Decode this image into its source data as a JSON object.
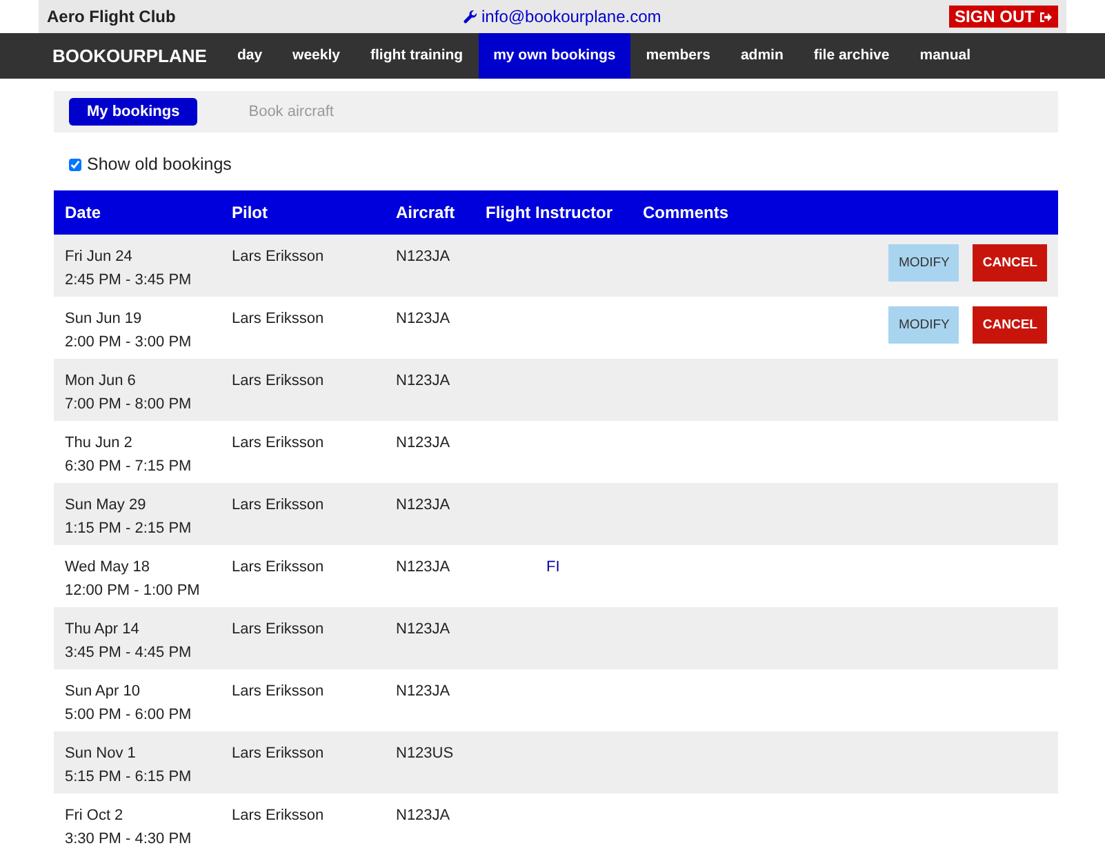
{
  "topbar": {
    "club": "Aero Flight Club",
    "email": "info@bookourplane.com",
    "sign_out": "SIGN OUT"
  },
  "navbar": {
    "brand": "BOOKOURPLANE",
    "items": [
      {
        "label": "day",
        "selected": false
      },
      {
        "label": "weekly",
        "selected": false
      },
      {
        "label": "flight training",
        "selected": false
      },
      {
        "label": "my own bookings",
        "selected": true
      },
      {
        "label": "members",
        "selected": false
      },
      {
        "label": "admin",
        "selected": false
      },
      {
        "label": "file archive",
        "selected": false
      },
      {
        "label": "manual",
        "selected": false
      }
    ]
  },
  "subnav": [
    {
      "label": "My bookings",
      "selected": true
    },
    {
      "label": "Book aircraft",
      "selected": false
    }
  ],
  "show_old": {
    "label": "Show old bookings",
    "checked": true
  },
  "table": {
    "columns": [
      "Date",
      "Pilot",
      "Aircraft",
      "Flight Instructor",
      "Comments"
    ],
    "rows": [
      {
        "date": "Fri Jun 24",
        "time": "2:45 PM - 3:45 PM",
        "pilot": "Lars Eriksson",
        "aircraft": "N123JA",
        "actions": [
          "MODIFY",
          "CANCEL"
        ]
      },
      {
        "date": "Sun Jun 19",
        "time": "2:00 PM - 3:00 PM",
        "pilot": "Lars Eriksson",
        "aircraft": "N123JA",
        "actions": [
          "MODIFY",
          "CANCEL"
        ]
      },
      {
        "date": "Mon Jun 6",
        "time": "7:00 PM - 8:00 PM",
        "pilot": "Lars Eriksson",
        "aircraft": "N123JA"
      },
      {
        "date": "Thu Jun 2",
        "time": "6:30 PM - 7:15 PM",
        "pilot": "Lars Eriksson",
        "aircraft": "N123JA"
      },
      {
        "date": "Sun May 29",
        "time": "1:15 PM - 2:15 PM",
        "pilot": "Lars Eriksson",
        "aircraft": "N123JA"
      },
      {
        "date": "Wed May 18",
        "time": "12:00 PM - 1:00 PM",
        "pilot": "Lars Eriksson",
        "aircraft": "N123JA",
        "instructor": "FI"
      },
      {
        "date": "Thu Apr 14",
        "time": "3:45 PM - 4:45 PM",
        "pilot": "Lars Eriksson",
        "aircraft": "N123JA"
      },
      {
        "date": "Sun Apr 10",
        "time": "5:00 PM - 6:00 PM",
        "pilot": "Lars Eriksson",
        "aircraft": "N123JA"
      },
      {
        "date": "Sun Nov 1",
        "time": "5:15 PM - 6:15 PM",
        "pilot": "Lars Eriksson",
        "aircraft": "N123US"
      },
      {
        "date": "Fri Oct 2",
        "time": "3:30 PM - 4:30 PM",
        "pilot": "Lars Eriksson",
        "aircraft": "N123JA"
      }
    ]
  }
}
